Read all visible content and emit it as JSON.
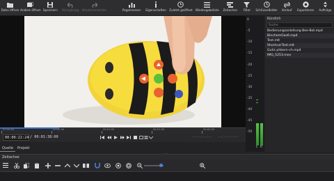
{
  "toolbar": {
    "items": [
      {
        "label": "Datei öffnen",
        "icon": "folder-open-icon",
        "enabled": true
      },
      {
        "label": "Andere öffnen",
        "icon": "open-other-icon",
        "enabled": true
      },
      {
        "label": "Speichern",
        "icon": "save-icon",
        "enabled": true
      },
      {
        "label": "Rückgängig",
        "icon": "undo-icon",
        "enabled": false
      },
      {
        "label": "Wiederherstellen",
        "icon": "redo-icon",
        "enabled": false
      },
      {
        "label": "Pegelmesser",
        "icon": "level-meter-icon",
        "enabled": true
      },
      {
        "label": "Eigenschaften",
        "icon": "properties-icon",
        "enabled": true
      },
      {
        "label": "Zuletzt geöffnet",
        "icon": "recent-icon",
        "enabled": true
      },
      {
        "label": "Wiedergabeliste",
        "icon": "playlist-icon",
        "enabled": true
      },
      {
        "label": "Zeitachse",
        "icon": "timeline-icon",
        "enabled": true
      },
      {
        "label": "Filter",
        "icon": "filter-icon",
        "enabled": true
      },
      {
        "label": "Schlüsselbilder",
        "icon": "keyframes-icon",
        "enabled": true
      },
      {
        "label": "Verlauf",
        "icon": "history-icon",
        "enabled": true
      },
      {
        "label": "Exportieren",
        "icon": "export-icon",
        "enabled": true
      },
      {
        "label": "Aufträge",
        "icon": "jobs-icon",
        "enabled": true
      }
    ]
  },
  "recent": {
    "title": "Kürzlich",
    "search_placeholder": "Suche",
    "items": [
      "Bedienungsanleitung Bee-Bot.mp4",
      "BinchemGas6.mp4",
      "Test.mlt",
      "Shortcut-Test.mlt",
      "Gutis phbern-ch.mp4",
      "IMG_5253.mov"
    ]
  },
  "meter": {
    "labels": [
      "0",
      "-5",
      "-10",
      "-15",
      "-20",
      "-25",
      "-30",
      "-35",
      "-40",
      "-45",
      "-50"
    ],
    "channels": [
      "L",
      "R"
    ],
    "left_level": 0.2,
    "right_level": 0.2
  },
  "ruler": {
    "ticks": [
      "00:00:00",
      "00:00:30",
      "00:01:00",
      "00:01:30",
      "00:02:00"
    ]
  },
  "transport": {
    "current_time": "00:00:22:24",
    "total_time": "/ 00:01:38:00",
    "in_point": "--:--:--:--",
    "out_point": "--:--:--:--",
    "progress": 0.24
  },
  "tabs": {
    "source": "Quelle",
    "project": "Projekt"
  },
  "timeline": {
    "title": "Zeitachse",
    "zoom": 0.85
  },
  "colors": {
    "accent": "#3c6fc4",
    "meter_green": "#5ac14a"
  }
}
